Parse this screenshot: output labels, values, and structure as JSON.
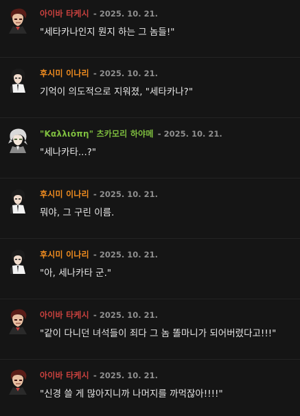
{
  "colors": {
    "background": "#151515",
    "aiba": "#c9413e",
    "fushimi": "#f08c1f",
    "kalliope": "#7fbf3f",
    "date": "#8f8f8f",
    "text": "#e6e6e6"
  },
  "separator": "-",
  "messages": [
    {
      "avatar": "aiba-avatar",
      "name": "아이바 타케시",
      "date": "2025. 10. 21.",
      "text": "\"세타카나인지 뭔지 하는 그 놈들!\""
    },
    {
      "avatar": "fushimi-avatar",
      "name": "후시미 이나리",
      "date": "2025. 10. 21.",
      "text": "기억이 의도적으로 지워졌, \"세타카나?\""
    },
    {
      "avatar": "kalliope-avatar",
      "name": "\"Καλλιόπη\" 츠카모리 하야메",
      "date": "2025. 10. 21.",
      "text": "\"세나카타...?\""
    },
    {
      "avatar": "fushimi-avatar",
      "name": "후시미 이나리",
      "date": "2025. 10. 21.",
      "text": "뭐야, 그 구린 이름."
    },
    {
      "avatar": "fushimi-avatar",
      "name": "후시미 이나리",
      "date": "2025. 10. 21.",
      "text": "\"아, 세나카타 군.\""
    },
    {
      "avatar": "aiba-avatar",
      "name": "아이바 타케시",
      "date": "2025. 10. 21.",
      "text": "\"같이 다니던 녀석들이 죄다 그 놈 똘마니가 되어버렸다고!!!\""
    },
    {
      "avatar": "aiba-avatar",
      "name": "아이바 타케시",
      "date": "2025. 10. 21.",
      "text": "\"신경 쓸 게 많아지니까 나머지를 까먹잖아!!!!\""
    }
  ]
}
